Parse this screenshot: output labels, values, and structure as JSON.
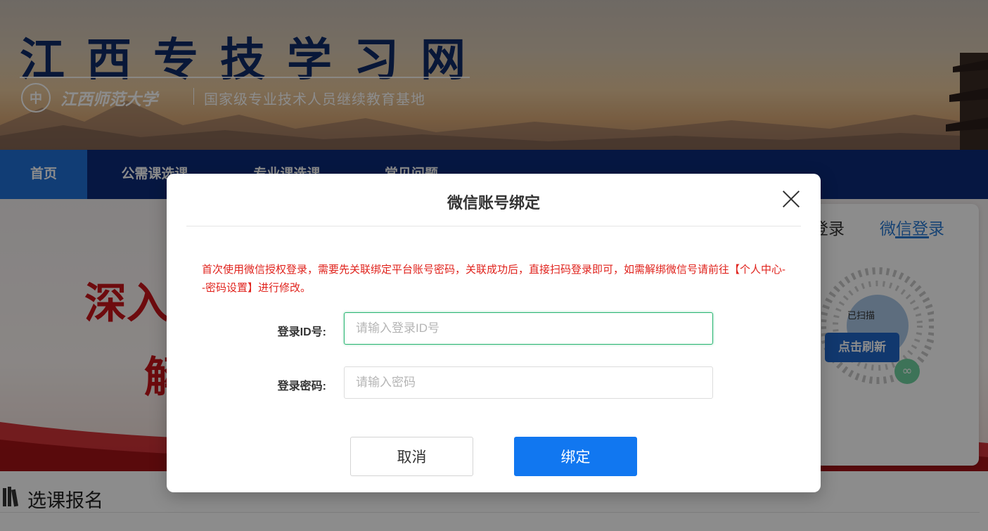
{
  "banner": {
    "site_title": "江西专技学习网",
    "logo_glyph": "中",
    "university": "江西师范大学",
    "tagline": "国家级专业技术人员继续教育基地"
  },
  "nav": {
    "items": [
      {
        "label": "首页",
        "active": true
      },
      {
        "label": "公需课选课",
        "active": false
      },
      {
        "label": "专业课选课",
        "active": false
      },
      {
        "label": "常见问题",
        "active": false
      }
    ]
  },
  "hero": {
    "line1": "深入学",
    "line2": "解"
  },
  "login_card": {
    "tab_password": "登录",
    "tab_wechat": "微信登录",
    "qr_status": "已扫描",
    "refresh_label": "点击刷新"
  },
  "section": {
    "title": "选课报名"
  },
  "modal": {
    "title": "微信账号绑定",
    "notice": "首次使用微信授权登录，需要先关联绑定平台账号密码，关联成功后，直接扫码登录即可，如需解绑微信号请前往【个人中心--密码设置】进行修改。",
    "id_label": "登录ID号:",
    "id_placeholder": "请输入登录ID号",
    "id_value": "",
    "pw_label": "登录密码:",
    "pw_placeholder": "请输入密码",
    "pw_value": "",
    "cancel_label": "取消",
    "bind_label": "绑定"
  },
  "colors": {
    "nav_bg": "#0b2a78",
    "nav_active": "#1f6fd6",
    "primary_button": "#1177f0",
    "notice_red": "#e0231d",
    "focus_green": "#2bb673",
    "wechat_blue": "#2a7bd4"
  },
  "icons": [
    "close-icon",
    "qr-code-icon",
    "mini-program-icon",
    "books-icon",
    "university-logo-icon"
  ]
}
